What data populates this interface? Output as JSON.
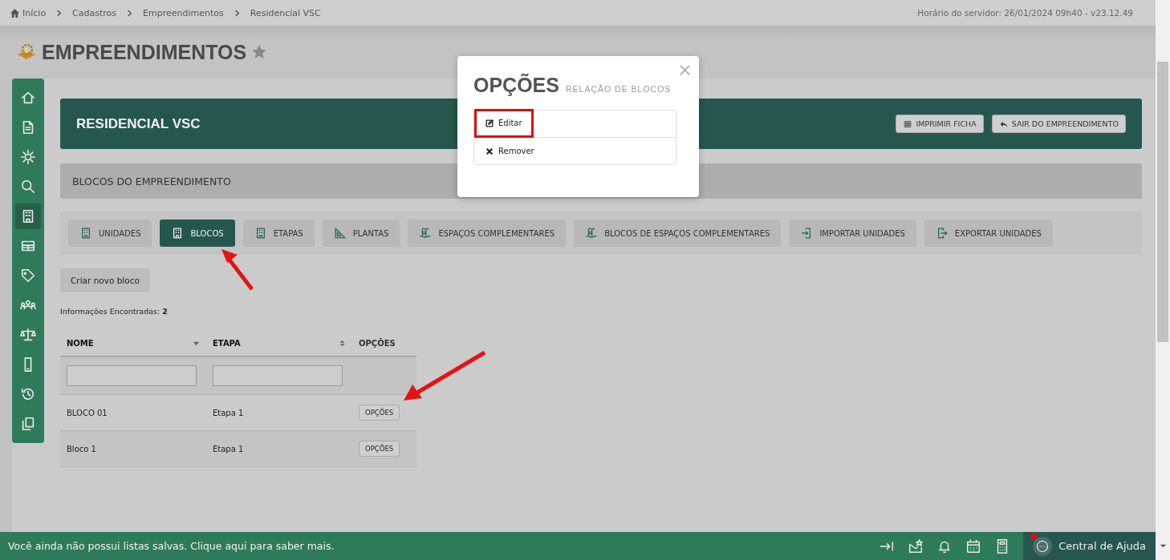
{
  "breadcrumb": [
    "Início",
    "Cadastros",
    "Empreendimentos",
    "Residencial VSC"
  ],
  "server_info": "Horário do servidor: 26/01/2024 09h40 - v23.12.49",
  "page_title": "EMPREENDIMENTOS",
  "sidebar": {
    "items": [
      {
        "kind": "home",
        "selected": false
      },
      {
        "kind": "document",
        "selected": false
      },
      {
        "kind": "gear",
        "selected": false
      },
      {
        "kind": "search",
        "selected": false
      },
      {
        "kind": "building",
        "selected": true
      },
      {
        "kind": "table",
        "selected": false
      },
      {
        "kind": "tag",
        "selected": false
      },
      {
        "kind": "people",
        "selected": false
      },
      {
        "kind": "scales",
        "selected": false
      },
      {
        "kind": "phone",
        "selected": false
      },
      {
        "kind": "history",
        "selected": false
      },
      {
        "kind": "copy",
        "selected": false
      }
    ]
  },
  "header": {
    "title": "RESIDENCIAL VSC",
    "buttons": [
      {
        "label": "IMPRIMIR FICHA",
        "kind": "list"
      },
      {
        "label": "SAIR DO EMPREENDIMENTO",
        "kind": "reply"
      }
    ]
  },
  "section_title": "BLOCOS DO EMPREENDIMENTO",
  "tabs": [
    {
      "label": "UNIDADES",
      "kind": "building",
      "selected": false
    },
    {
      "label": "BLOCOS",
      "kind": "building",
      "selected": true
    },
    {
      "label": "ETAPAS",
      "kind": "building",
      "selected": false
    },
    {
      "label": "PLANTAS",
      "kind": "ruler",
      "selected": false
    },
    {
      "label": "ESPAÇOS COMPLEMENTARES",
      "kind": "pool",
      "selected": false
    },
    {
      "label": "BLOCOS DE ESPAÇOS COMPLEMENTARES",
      "kind": "pool",
      "selected": false
    },
    {
      "label": "IMPORTAR UNIDADES",
      "kind": "import",
      "selected": false
    },
    {
      "label": "EXPORTAR UNIDADES",
      "kind": "export",
      "selected": false
    }
  ],
  "create_button": "Criar novo bloco",
  "count": {
    "label": "Informações Encontradas:",
    "value": "2"
  },
  "table": {
    "columns": [
      {
        "label": "NOME",
        "sortable": true,
        "sorted": true
      },
      {
        "label": "ETAPA",
        "sortable": true,
        "sorted": false
      },
      {
        "label": "OPÇÕES",
        "sortable": false,
        "sorted": false
      }
    ],
    "rows": [
      {
        "nome": "BLOCO 01",
        "etapa": "Etapa 1",
        "action": "OPÇÕES"
      },
      {
        "nome": "Bloco 1",
        "etapa": "Etapa 1",
        "action": "OPÇÕES"
      }
    ]
  },
  "footer": {
    "message": "Você ainda não possui listas salvas. Clique aqui para saber mais.",
    "help": "Central de Ajuda"
  },
  "modal": {
    "title": "OPÇÕES",
    "subtitle": "RELAÇÃO DE BLOCOS",
    "options": [
      {
        "label": "Editar",
        "kind": "edit",
        "highlighted": true
      },
      {
        "label": "Remover",
        "kind": "remove",
        "highlighted": false
      }
    ]
  }
}
